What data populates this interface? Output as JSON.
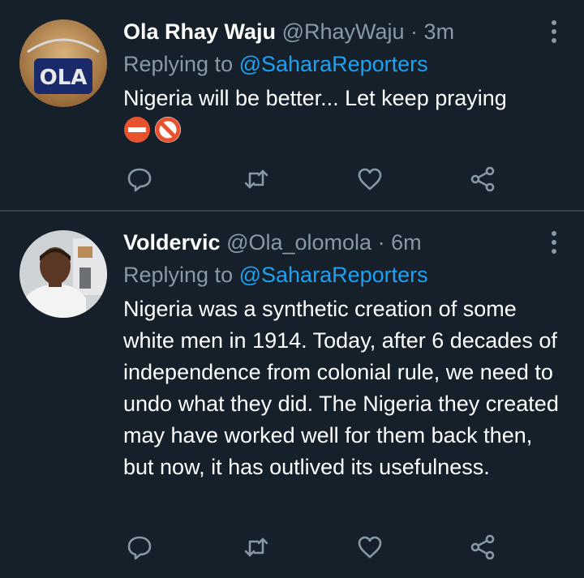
{
  "colors": {
    "background": "#15202b",
    "divider": "#38444d",
    "secondary_text": "#8899a6",
    "link": "#1da1f2",
    "primary_text": "#ffffff"
  },
  "tweets": [
    {
      "display_name": "Ola Rhay Waju",
      "handle": "@RhayWaju",
      "separator": "·",
      "time": "3m",
      "replying_prefix": "Replying to",
      "replying_to": "@SaharaReporters",
      "text": "Nigeria will be better... Let keep praying",
      "emojis": [
        "no-entry-icon",
        "prohibited-icon"
      ],
      "avatar_text": "OLA"
    },
    {
      "display_name": "Voldervic",
      "handle": "@Ola_olomola",
      "separator": "·",
      "time": "6m",
      "replying_prefix": "Replying to",
      "replying_to": "@SaharaReporters",
      "text": "Nigeria was a synthetic creation of some white men in 1914. Today, after 6 decades of independence from colonial rule, we need to undo what they did. The Nigeria they created may have worked well for them back then, but now, it has outlived its usefulness."
    }
  ]
}
